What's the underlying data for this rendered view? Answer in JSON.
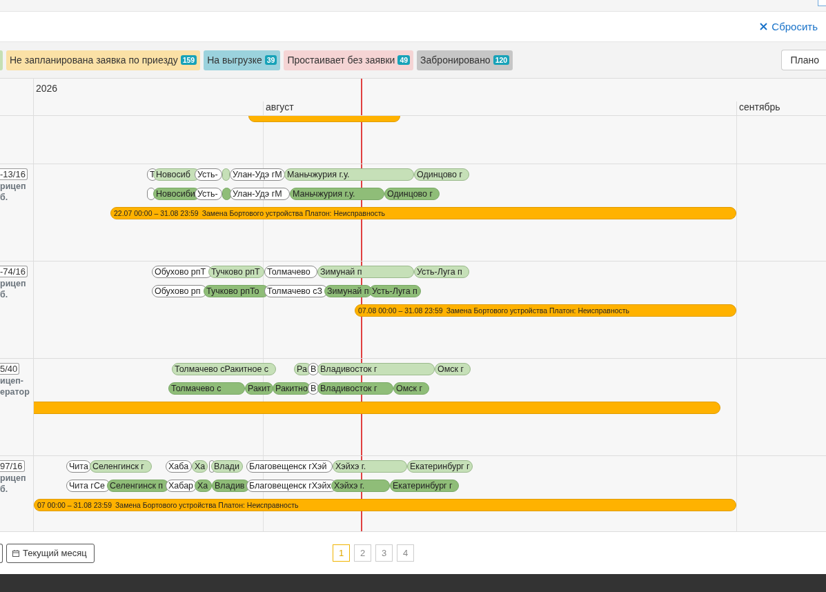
{
  "toolbar": {
    "reset": "Сбросить"
  },
  "filters": [
    {
      "color": "#c5e0b4"
    },
    {
      "label": "Не запланирована заявка по приезду",
      "count": "159",
      "color": "#fbe1a6"
    },
    {
      "label": "На выгрузке",
      "count": "39",
      "color": "#9bd2dd"
    },
    {
      "label": "Простаивает без заявки",
      "count": "49",
      "color": "#f5d4d4"
    },
    {
      "label": "Забронировано",
      "count": "120",
      "color": "#c6c6c6"
    }
  ],
  "view_button": "Плано",
  "timeline": {
    "year": "2026",
    "months": [
      "август",
      "сентябрь"
    ]
  },
  "rows": [
    {
      "repairs": [
        {
          "kind": "repair"
        }
      ]
    },
    {
      "plate": "-13/16",
      "type": [
        "рицеп",
        "б."
      ],
      "plan": [
        {
          "kind": "empty",
          "label": "Т"
        },
        {
          "kind": "planned",
          "label": "Новосиб"
        },
        {
          "kind": "empty",
          "label": "Усть-"
        },
        {
          "kind": "planned"
        },
        {
          "kind": "empty",
          "label": "Улан-Удэ гМ"
        },
        {
          "kind": "planned",
          "label": "Маньчжурия г.у."
        },
        {
          "kind": "planned",
          "label": "Одинцово г"
        }
      ],
      "fact": [
        {
          "kind": "empty"
        },
        {
          "kind": "done",
          "label": "Новосиби"
        },
        {
          "kind": "empty",
          "label": "Усть-"
        },
        {
          "kind": "done"
        },
        {
          "kind": "empty",
          "label": "Улан-Удэ гМ"
        },
        {
          "kind": "done",
          "label": "Маньчжурия г.у."
        },
        {
          "kind": "done",
          "label": "Одинцово г"
        }
      ],
      "repairs": [
        {
          "kind": "repair",
          "period": "22.07 00:00 – 31.08 23:59",
          "reason": "Замена Бортового устройства Платон: Неисправность"
        }
      ]
    },
    {
      "plate": "-74/16",
      "type": [
        "рицеп",
        "б."
      ],
      "plan": [
        {
          "kind": "empty",
          "label": "Обухово рпТ"
        },
        {
          "kind": "planned",
          "label": "Тучково рпТ"
        },
        {
          "kind": "empty",
          "label": "Толмачево"
        },
        {
          "kind": "planned",
          "label": "Зимунай п"
        },
        {
          "kind": "planned",
          "label": "Усть-Луга п"
        }
      ],
      "fact": [
        {
          "kind": "empty",
          "label": "Обухово рп"
        },
        {
          "kind": "done",
          "label": "Тучково рпТо"
        },
        {
          "kind": "empty",
          "label": "Толмачево сЗ"
        },
        {
          "kind": "done",
          "label": "Зимунай п"
        },
        {
          "kind": "done",
          "label": "Усть-Луга п"
        }
      ],
      "repairs": [
        {
          "kind": "repair",
          "period": "07.08 00:00 – 31.08 23:59",
          "reason": "Замена Бортового устройства Платон: Неисправность"
        }
      ]
    },
    {
      "plate": "5/40",
      "type": [
        "ицеп-",
        "ератор"
      ],
      "plan": [
        {
          "kind": "planned",
          "label": "Толмачево сРакитное с"
        },
        {
          "kind": "planned",
          "label": "Ра"
        },
        {
          "kind": "empty",
          "label": "В"
        },
        {
          "kind": "planned",
          "label": "Владивосток г"
        },
        {
          "kind": "planned",
          "label": "Омск г"
        }
      ],
      "fact": [
        {
          "kind": "done",
          "label": "Толмачево с"
        },
        {
          "kind": "done",
          "label": "Ракит"
        },
        {
          "kind": "done",
          "label": "Ракитно"
        },
        {
          "kind": "empty",
          "label": "В"
        },
        {
          "kind": "done",
          "label": "Владивосток г"
        },
        {
          "kind": "done",
          "label": "Омск г"
        }
      ],
      "repairs": [
        {
          "kind": "repair"
        }
      ]
    },
    {
      "plate": "97/16",
      "type": [
        "рицеп",
        "б."
      ],
      "plan": [
        {
          "kind": "empty",
          "label": "Чита"
        },
        {
          "kind": "planned",
          "label": "Селенгинск г"
        },
        {
          "kind": "empty",
          "label": "Хаба"
        },
        {
          "kind": "planned",
          "label": "Ха"
        },
        {
          "kind": "empty"
        },
        {
          "kind": "planned",
          "label": "Влади"
        },
        {
          "kind": "empty",
          "label": "Благовещенск гХэй"
        },
        {
          "kind": "planned",
          "label": "Хэйхэ г."
        },
        {
          "kind": "planned",
          "label": "Екатеринбург г"
        }
      ],
      "fact": [
        {
          "kind": "empty",
          "label": "Чита гСе"
        },
        {
          "kind": "done",
          "label": "Селенгинск п"
        },
        {
          "kind": "empty",
          "label": "Хабар"
        },
        {
          "kind": "done",
          "label": "Ха"
        },
        {
          "kind": "done",
          "label": "Владив"
        },
        {
          "kind": "empty",
          "label": "Благовещенск гХэйх"
        },
        {
          "kind": "done",
          "label": "Хэйхэ г."
        },
        {
          "kind": "done",
          "label": "Екатеринбург г"
        }
      ],
      "repairs": [
        {
          "kind": "repair",
          "period": "07 00:00 – 31.08 23:59",
          "reason": "Замена Бортового устройства Платон: Неисправность"
        }
      ]
    }
  ],
  "footer": {
    "current_month": "Текущий месяц",
    "pages": [
      {
        "label": "1",
        "selected": true
      },
      {
        "label": "2",
        "selected": false
      },
      {
        "label": "3",
        "selected": false
      },
      {
        "label": "4",
        "selected": false
      }
    ]
  }
}
